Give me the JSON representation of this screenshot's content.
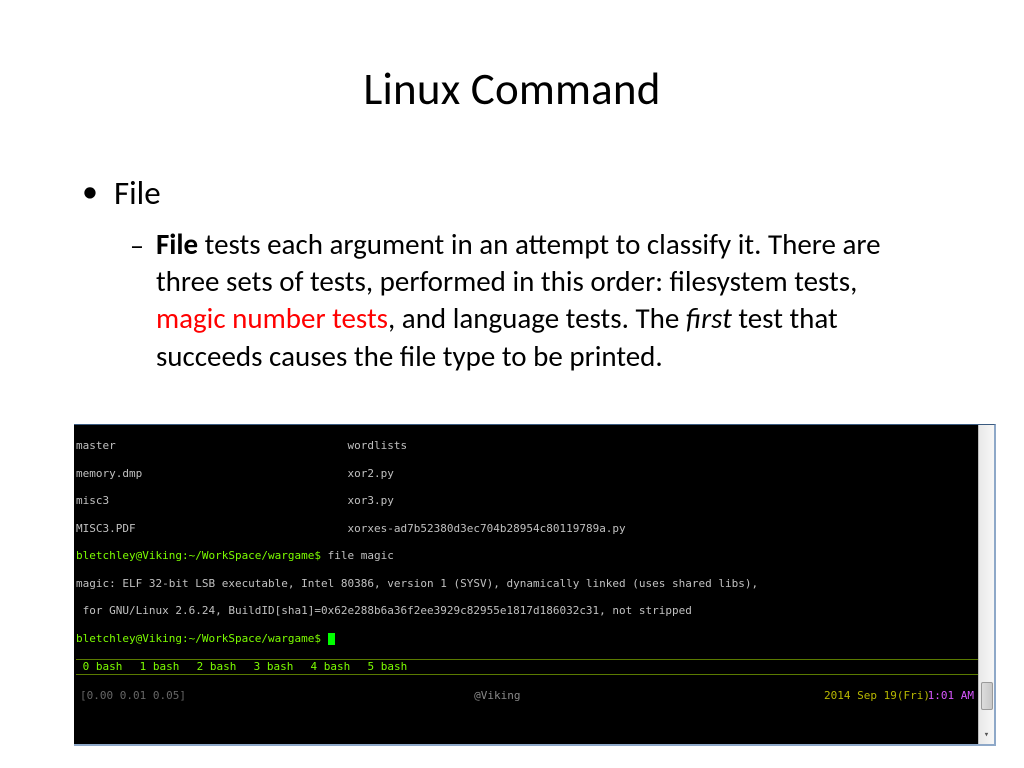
{
  "title": "Linux Command",
  "bullet1": "File",
  "body": {
    "bold_lead": "File",
    "part1": " tests each argument in an attempt to classify it. There are three sets of tests, performed in this order: filesystem tests, ",
    "red": "magic number tests",
    "part2": ", and language tests. The ",
    "italic": "first",
    "part3": " test that succeeds causes the file type to be printed."
  },
  "terminal": {
    "row1_left": "master",
    "row1_right": "wordlists",
    "row2_left": "memory.dmp",
    "row2_right": "xor2.py",
    "row3_left": "misc3",
    "row3_right": "xor3.py",
    "row4_left": "MISC3.PDF",
    "row4_right": "xorxes-ad7b52380d3ec704b28954c80119789a.py",
    "prompt1": "bletchley@Viking:~/WorkSpace/wargame$ ",
    "cmd1": "file magic",
    "out1": "magic: ELF 32-bit LSB executable, Intel 80386, version 1 (SYSV), dynamically linked (uses shared libs),",
    "out2": " for GNU/Linux 2.6.24, BuildID[sha1]=0x62e288b6a36f2ee3929c82955e1817d186032c31, not stripped",
    "prompt2": "bletchley@Viking:~/WorkSpace/wargame$ ",
    "tabs": [
      " 0 bash",
      " 1 bash",
      " 2 bash",
      " 3 bash",
      " 4 bash",
      " 5 bash"
    ],
    "load": "[0.00 0.01 0.05]",
    "host": "@Viking",
    "date": "2014 Sep 19(Fri)",
    "time": "1:01 AM"
  }
}
